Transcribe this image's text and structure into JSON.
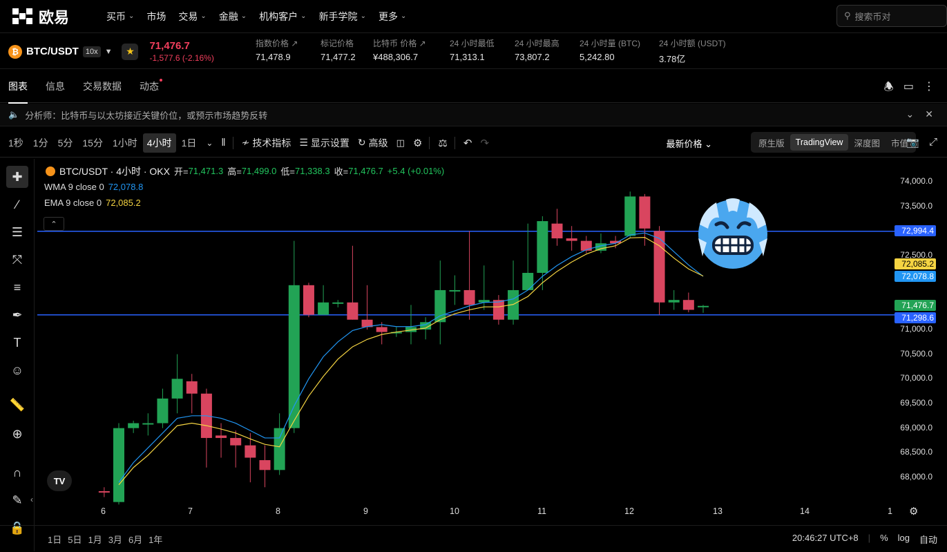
{
  "nav": {
    "logo_text": "欧易",
    "items": [
      {
        "label": "买币",
        "chev": true
      },
      {
        "label": "市场",
        "chev": false
      },
      {
        "label": "交易",
        "chev": true
      },
      {
        "label": "金融",
        "chev": true
      },
      {
        "label": "机构客户",
        "chev": true
      },
      {
        "label": "新手学院",
        "chev": true
      },
      {
        "label": "更多",
        "chev": true
      }
    ],
    "search_placeholder": "搜索币对"
  },
  "ticker": {
    "coin_symbol": "₿",
    "pair": "BTC/USDT",
    "leverage": "10x",
    "price": "71,476.7",
    "change": "-1,577.6 (-2.16%)",
    "stats": [
      {
        "label": "指数价格 ↗",
        "value": "71,478.9"
      },
      {
        "label": "标记价格",
        "value": "71,477.2"
      },
      {
        "label": "比特币 价格 ↗",
        "value": "¥488,306.7"
      },
      {
        "label": "24 小时最低",
        "value": "71,313.1"
      },
      {
        "label": "24 小时最高",
        "value": "73,807.2"
      },
      {
        "label": "24 小时量 (BTC)",
        "value": "5,242.80"
      },
      {
        "label": "24 小时额 (USDT)",
        "value": "3.78亿"
      }
    ]
  },
  "tabs": [
    {
      "label": "图表",
      "active": true
    },
    {
      "label": "信息",
      "active": false
    },
    {
      "label": "交易数据",
      "active": false
    },
    {
      "label": "动态",
      "active": false,
      "dot": true
    }
  ],
  "notice": {
    "text": "分析师：比特币与以太坊接近关键价位，或预示市场趋势反转"
  },
  "toolbar": {
    "timeframes": [
      {
        "label": "1秒",
        "active": false
      },
      {
        "label": "1分",
        "active": false
      },
      {
        "label": "5分",
        "active": false
      },
      {
        "label": "15分",
        "active": false
      },
      {
        "label": "1小时",
        "active": false
      },
      {
        "label": "4小时",
        "active": true
      },
      {
        "label": "1日",
        "active": false
      }
    ],
    "indicators": "技术指标",
    "display": "显示设置",
    "advanced": "高级",
    "latest_price": "最新价格",
    "views": [
      {
        "label": "原生版",
        "active": false
      },
      {
        "label": "TradingView",
        "active": true
      },
      {
        "label": "深度图",
        "active": false
      },
      {
        "label": "市值",
        "active": false
      }
    ]
  },
  "legend": {
    "title": "BTC/USDT · 4小时 · OKX",
    "open_label": "开=",
    "open": "71,471.3",
    "high_label": "高=",
    "high": "71,499.0",
    "low_label": "低=",
    "low": "71,338.3",
    "close_label": "收=",
    "close": "71,476.7",
    "change": "+5.4 (+0.01%)",
    "wma_label": "WMA 9 close 0",
    "wma_value": "72,078.8",
    "ema_label": "EMA 9 close 0",
    "ema_value": "72,085.2"
  },
  "chart_data": {
    "type": "candlestick",
    "y_ticks": [
      "74,000.0",
      "73,500.0",
      "73,000.0",
      "72,500.0",
      "71,000.0",
      "70,500.0",
      "70,000.0",
      "69,500.0",
      "69,000.0",
      "68,500.0",
      "68,000.0"
    ],
    "x_ticks": [
      "6",
      "7",
      "8",
      "9",
      "10",
      "11",
      "12",
      "13",
      "14",
      "1"
    ],
    "price_labels": [
      {
        "value": "72,994.4",
        "color": "#2962ff",
        "text_color": "#ffffff"
      },
      {
        "value": "72,085.2",
        "color": "#f5d442",
        "text_color": "#000000"
      },
      {
        "value": "72,078.8",
        "color": "#2196f3",
        "text_color": "#ffffff"
      },
      {
        "value": "71,476.7",
        "color": "#22a355",
        "text_color": "#ffffff"
      },
      {
        "value": "71,298.6",
        "color": "#2962ff",
        "text_color": "#ffffff"
      }
    ],
    "hlines": [
      72994.4,
      71298.6
    ],
    "candles": [
      [
        67720,
        67700,
        67800,
        67600
      ],
      [
        67500,
        69000,
        69100,
        67450
      ],
      [
        69000,
        69100,
        69150,
        68900
      ],
      [
        69100,
        69100,
        69300,
        68850
      ],
      [
        69100,
        69600,
        69800,
        69000
      ],
      [
        69600,
        70000,
        70500,
        69300
      ],
      [
        69950,
        69700,
        70100,
        69300
      ],
      [
        69700,
        68800,
        69800,
        68200
      ],
      [
        68850,
        68800,
        69100,
        68400
      ],
      [
        68800,
        68650,
        68950,
        68200
      ],
      [
        68650,
        68400,
        68900,
        67900
      ],
      [
        68350,
        68150,
        68650,
        67800
      ],
      [
        68150,
        69000,
        69300,
        68050
      ],
      [
        69000,
        71900,
        72800,
        68900
      ],
      [
        71900,
        71300,
        71950,
        71250
      ],
      [
        71300,
        71550,
        71900,
        71300
      ],
      [
        71550,
        71550,
        71600,
        71450
      ],
      [
        71550,
        71200,
        72700,
        71200
      ],
      [
        71200,
        71050,
        71900,
        71000
      ],
      [
        71050,
        70950,
        71150,
        70700
      ],
      [
        70950,
        70950,
        71050,
        70850
      ],
      [
        70950,
        71050,
        71500,
        70700
      ],
      [
        71000,
        71150,
        71250,
        70800
      ],
      [
        71150,
        71800,
        72400,
        70700
      ],
      [
        71800,
        71800,
        72100,
        71500
      ],
      [
        71800,
        71500,
        73000,
        71200
      ],
      [
        71550,
        71600,
        72300,
        71400
      ],
      [
        71600,
        71200,
        71700,
        71100
      ],
      [
        71200,
        71800,
        72400,
        71100
      ],
      [
        71800,
        72150,
        73150,
        71950
      ],
      [
        72150,
        73200,
        73300,
        71800
      ],
      [
        73150,
        72850,
        73450,
        72700
      ],
      [
        72850,
        72800,
        73100,
        72600
      ],
      [
        72800,
        72600,
        72900,
        72550
      ],
      [
        72600,
        72750,
        72950,
        72550
      ],
      [
        72800,
        72750,
        72900,
        72650
      ],
      [
        72900,
        73700,
        73800,
        72850
      ],
      [
        73700,
        73050,
        73750,
        72700
      ],
      [
        73000,
        71550,
        73100,
        71300
      ],
      [
        71550,
        71600,
        71800,
        71400
      ],
      [
        71600,
        71400,
        71750,
        71350
      ],
      [
        71470,
        71480,
        71500,
        71340
      ]
    ],
    "wma": [
      null,
      67900,
      68300,
      68600,
      68900,
      69200,
      69250,
      69250,
      69200,
      69100,
      68950,
      68800,
      68800,
      69450,
      70000,
      70450,
      70750,
      70980,
      71060,
      71100,
      71060,
      71060,
      71100,
      71280,
      71380,
      71480,
      71550,
      71560,
      71620,
      71800,
      72080,
      72300,
      72480,
      72620,
      72700,
      72750,
      72920,
      72960,
      72850,
      72580,
      72310,
      72079
    ],
    "ema": [
      null,
      67850,
      68200,
      68450,
      68750,
      69050,
      69100,
      69050,
      68980,
      68900,
      68780,
      68670,
      68620,
      69150,
      69650,
      70050,
      70400,
      70650,
      70800,
      70900,
      70950,
      70990,
      71030,
      71200,
      71320,
      71400,
      71460,
      71460,
      71510,
      71670,
      71950,
      72180,
      72370,
      72530,
      72640,
      72700,
      72860,
      72870,
      72700,
      72450,
      72230,
      72085
    ]
  },
  "bottom": {
    "ranges": [
      "1日",
      "5日",
      "1月",
      "3月",
      "6月",
      "1年"
    ],
    "time": "20:46:27 UTC+8",
    "percent": "%",
    "log": "log",
    "auto": "自动"
  }
}
